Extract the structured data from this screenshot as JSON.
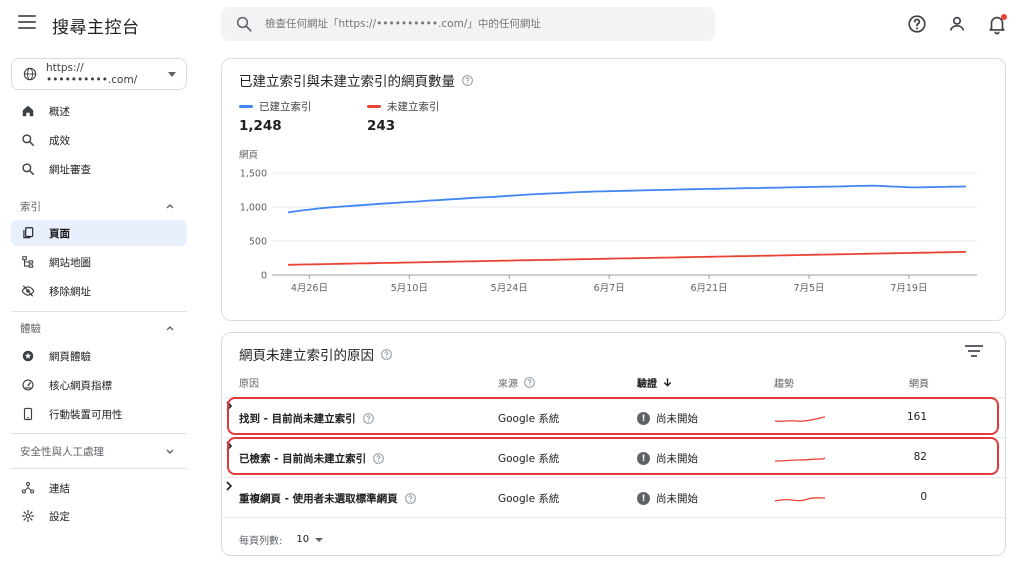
{
  "app": {
    "title": "搜尋主控台",
    "search_placeholder": "檢查任何網址「https://••••••••••.com/」中的任何網址"
  },
  "sidebar": {
    "property": "https://••••••••••.com/",
    "items_top": [
      {
        "label": "概述",
        "icon": "home-icon"
      },
      {
        "label": "成效",
        "icon": "search-icon"
      },
      {
        "label": "網址審查",
        "icon": "search-icon"
      }
    ],
    "section_index": "索引",
    "items_index": [
      {
        "label": "頁面",
        "icon": "pages-icon",
        "active": true
      },
      {
        "label": "網站地圖",
        "icon": "sitemap-icon"
      },
      {
        "label": "移除網址",
        "icon": "eye-off-icon"
      }
    ],
    "section_experience": "體驗",
    "items_experience": [
      {
        "label": "網頁體驗",
        "icon": "star-badge-icon"
      },
      {
        "label": "核心網頁指標",
        "icon": "gauge-icon"
      },
      {
        "label": "行動裝置可用性",
        "icon": "phone-icon"
      }
    ],
    "section_security": "安全性與人工處理",
    "items_bottom": [
      {
        "label": "連結",
        "icon": "links-icon"
      },
      {
        "label": "設定",
        "icon": "gear-icon"
      }
    ]
  },
  "chart_card": {
    "title": "已建立索引與未建立索引的網頁數量",
    "legend": [
      {
        "label": "已建立索引",
        "value": "1,248",
        "color": "#4285f4"
      },
      {
        "label": "未建立索引",
        "value": "243",
        "color": "#ea4335"
      }
    ]
  },
  "chart_data": {
    "type": "line",
    "ylabel": "網頁",
    "ylim": [
      0,
      1500
    ],
    "yticks": [
      "0",
      "500",
      "1,000",
      "1,500"
    ],
    "x_tick_labels": [
      "4月26日",
      "5月10日",
      "5月24日",
      "6月7日",
      "6月21日",
      "7月5日",
      "7月19日"
    ],
    "x_tick_index": [
      3,
      17,
      31,
      45,
      59,
      73,
      87
    ],
    "grid": true,
    "series": [
      {
        "name": "已建立索引",
        "color": "#4285f4",
        "values": [
          920,
          935,
          950,
          962,
          975,
          985,
          995,
          1002,
          1010,
          1018,
          1025,
          1032,
          1040,
          1048,
          1055,
          1060,
          1068,
          1075,
          1080,
          1088,
          1095,
          1100,
          1108,
          1115,
          1120,
          1128,
          1135,
          1140,
          1145,
          1150,
          1158,
          1165,
          1170,
          1178,
          1185,
          1190,
          1195,
          1200,
          1205,
          1210,
          1215,
          1220,
          1224,
          1228,
          1230,
          1232,
          1235,
          1238,
          1240,
          1242,
          1245,
          1248,
          1250,
          1252,
          1255,
          1258,
          1260,
          1262,
          1264,
          1266,
          1268,
          1270,
          1272,
          1274,
          1276,
          1278,
          1280,
          1282,
          1284,
          1286,
          1288,
          1290,
          1292,
          1294,
          1296,
          1298,
          1300,
          1302,
          1305,
          1308,
          1310,
          1312,
          1315,
          1310,
          1305,
          1300,
          1295,
          1290,
          1288,
          1290,
          1292,
          1294,
          1296,
          1298,
          1300,
          1302
        ]
      },
      {
        "name": "未建立索引",
        "color": "#ea4335",
        "values": [
          150,
          152,
          154,
          156,
          158,
          160,
          162,
          164,
          166,
          168,
          170,
          172,
          174,
          176,
          178,
          180,
          182,
          184,
          186,
          188,
          190,
          192,
          194,
          196,
          198,
          200,
          202,
          204,
          206,
          208,
          210,
          212,
          214,
          216,
          218,
          220,
          222,
          224,
          226,
          228,
          230,
          232,
          234,
          236,
          238,
          240,
          242,
          244,
          246,
          248,
          250,
          252,
          254,
          256,
          258,
          260,
          262,
          264,
          266,
          268,
          270,
          272,
          274,
          276,
          278,
          280,
          282,
          284,
          286,
          288,
          290,
          292,
          294,
          296,
          298,
          300,
          302,
          304,
          306,
          308,
          310,
          312,
          314,
          316,
          318,
          320,
          322,
          324,
          326,
          328,
          330,
          332,
          334,
          336,
          338,
          340
        ]
      }
    ]
  },
  "table_card": {
    "title": "網頁未建立索引的原因",
    "headers": {
      "reason": "原因",
      "source": "來源",
      "validation": "驗證",
      "trend": "趨勢",
      "pages": "網頁"
    },
    "rows": [
      {
        "reason": "找到 - 目前尚未建立索引",
        "source": "Google 系統",
        "status": "尚未開始",
        "pages": "161",
        "highlighted": true
      },
      {
        "reason": "已檢索 - 目前尚未建立索引",
        "source": "Google 系統",
        "status": "尚未開始",
        "pages": "82",
        "highlighted": true
      },
      {
        "reason": "重複網頁 - 使用者未選取標準網頁",
        "source": "Google 系統",
        "status": "尚未開始",
        "pages": "0",
        "highlighted": false
      }
    ],
    "footer_label": "每頁列數:",
    "rows_per_page": "10"
  }
}
